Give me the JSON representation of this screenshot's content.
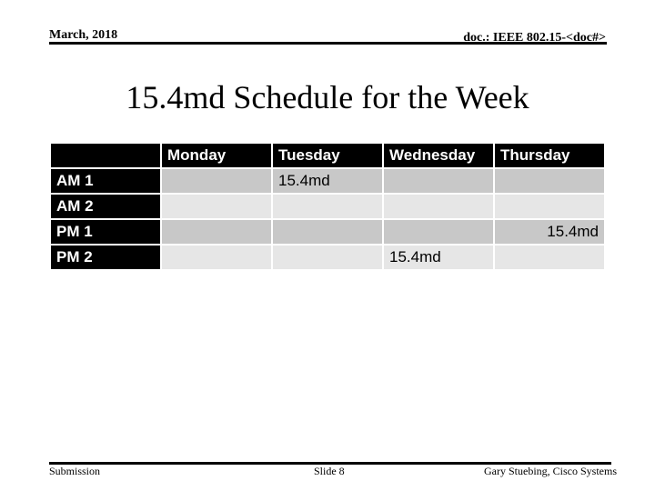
{
  "header": {
    "date": "March, 2018",
    "doc_id": "doc.: IEEE 802.15-<doc#>"
  },
  "title": "15.4md Schedule for the Week",
  "schedule": {
    "columns": [
      "",
      "Monday",
      "Tuesday",
      "Wednesday",
      "Thursday"
    ],
    "rows": [
      {
        "label": "AM 1",
        "cells": [
          "",
          "15.4md",
          "",
          ""
        ]
      },
      {
        "label": "AM 2",
        "cells": [
          "",
          "",
          "",
          ""
        ]
      },
      {
        "label": "PM 1",
        "cells": [
          "",
          "",
          "",
          "15.4md"
        ]
      },
      {
        "label": "PM 2",
        "cells": [
          "",
          "",
          "15.4md",
          ""
        ]
      }
    ]
  },
  "footer": {
    "left": "Submission",
    "center": "Slide 8",
    "right": "Gary Stuebing, Cisco Systems"
  }
}
